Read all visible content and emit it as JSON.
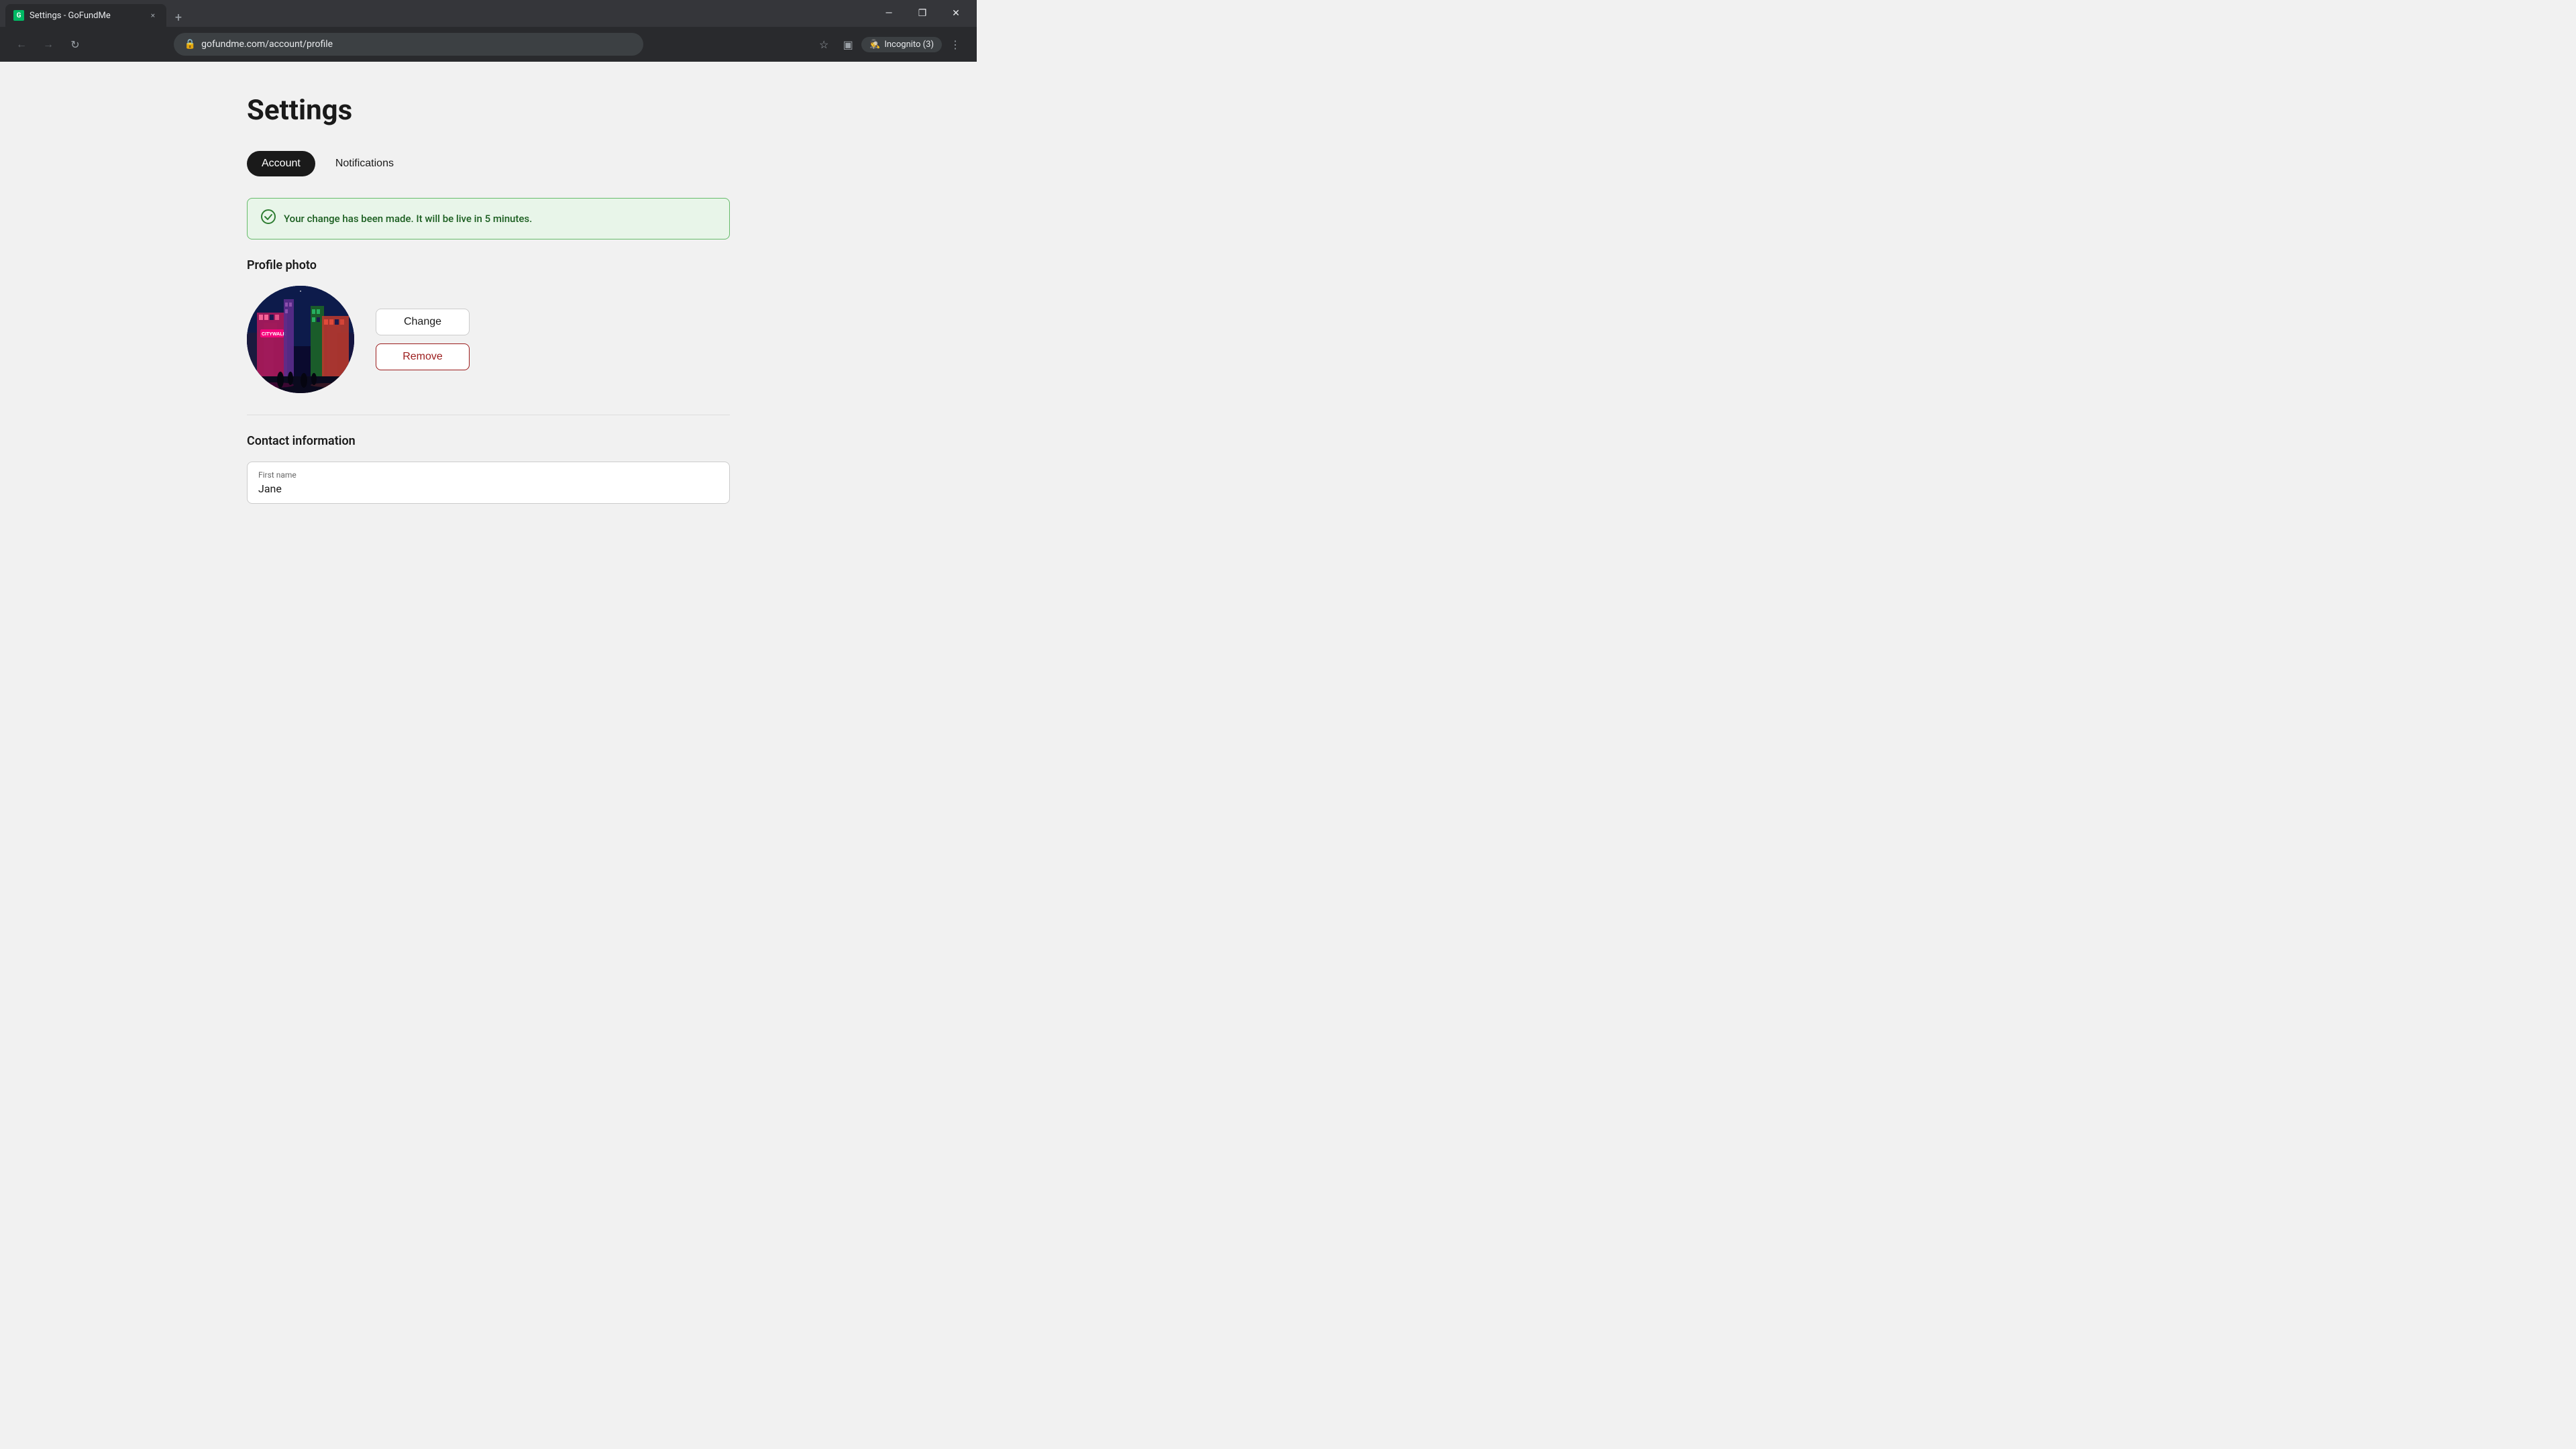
{
  "browser": {
    "tab": {
      "favicon_text": "G",
      "title": "Settings - GoFundMe",
      "close_label": "×"
    },
    "new_tab_label": "+",
    "window_controls": {
      "minimize": "—",
      "maximize": "❐",
      "close": "✕"
    },
    "nav": {
      "back_label": "←",
      "forward_label": "→",
      "refresh_label": "↻"
    },
    "address": "gofundme.com/account/profile",
    "incognito_label": "Incognito (3)",
    "toolbar": {
      "bookmark_label": "☆",
      "sidebar_label": "▣",
      "menu_label": "⋮"
    }
  },
  "page": {
    "title": "Settings",
    "tabs": [
      {
        "label": "Account",
        "active": true
      },
      {
        "label": "Notifications",
        "active": false
      }
    ],
    "success_banner": {
      "message": "Your change has been made. It will be live in 5 minutes.",
      "icon": "✓"
    },
    "profile_photo": {
      "section_title": "Profile photo",
      "change_btn": "Change",
      "remove_btn": "Remove"
    },
    "contact_info": {
      "section_title": "Contact information",
      "first_name_label": "First name",
      "first_name_value": "Jane"
    }
  }
}
